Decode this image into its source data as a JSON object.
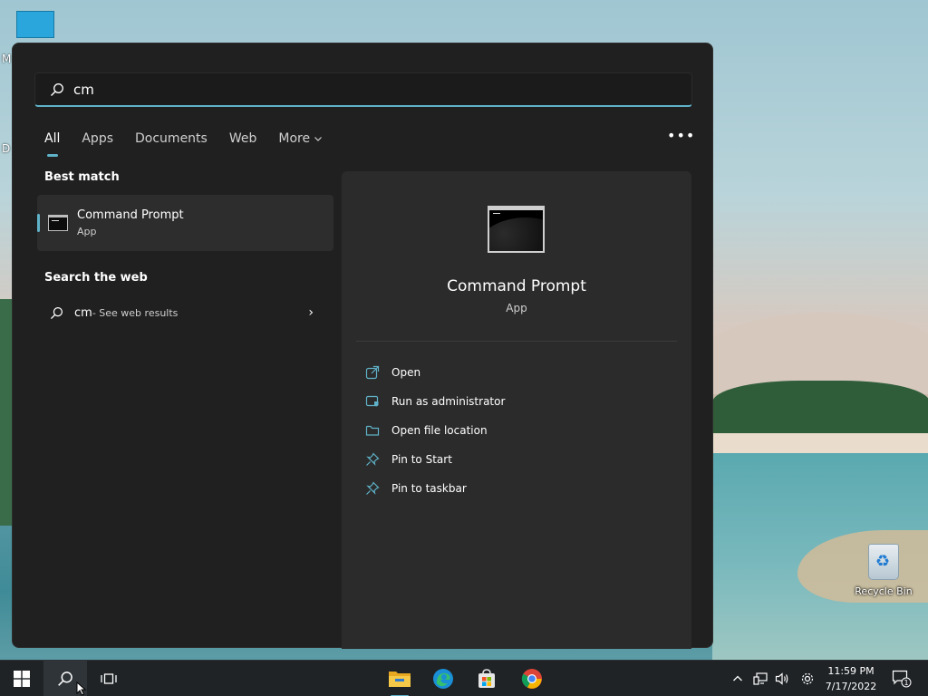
{
  "desktop": {
    "partial_labels": [
      "M",
      "D"
    ],
    "recycle_bin_label": "Recycle Bin"
  },
  "search": {
    "query": "cm",
    "tabs": [
      {
        "label": "All",
        "active": true
      },
      {
        "label": "Apps",
        "active": false
      },
      {
        "label": "Documents",
        "active": false
      },
      {
        "label": "Web",
        "active": false
      },
      {
        "label": "More",
        "active": false,
        "has_dropdown": true
      }
    ],
    "more_options_label": "•••",
    "best_match": {
      "section_title": "Best match",
      "name": "Command Prompt",
      "kind": "App",
      "icon": "command-prompt-icon"
    },
    "web": {
      "section_title": "Search the web",
      "query": "cm",
      "suffix": " - See web results",
      "chevron": "›"
    },
    "preview": {
      "title": "Command Prompt",
      "kind": "App",
      "actions": [
        {
          "label": "Open",
          "icon": "open-external-icon"
        },
        {
          "label": "Run as administrator",
          "icon": "admin-shield-icon"
        },
        {
          "label": "Open file location",
          "icon": "folder-icon"
        },
        {
          "label": "Pin to Start",
          "icon": "pin-icon"
        },
        {
          "label": "Pin to taskbar",
          "icon": "pin-icon"
        }
      ]
    }
  },
  "taskbar": {
    "clock_time": "11:59 PM",
    "clock_date": "7/17/2022",
    "notification_count": "1",
    "accent_color": "#5fb2c8"
  }
}
